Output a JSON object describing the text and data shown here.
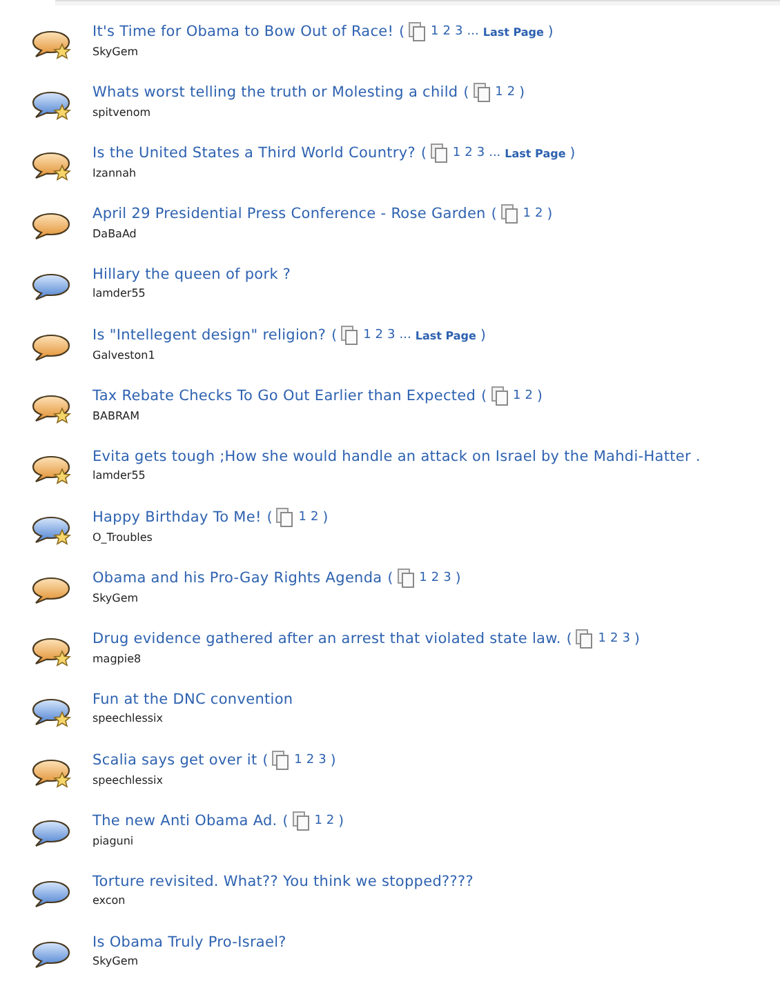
{
  "topics": [
    {
      "title": "It's Time for Obama to Bow Out of Race!",
      "author": "SkyGem",
      "hot": true,
      "starred": true,
      "pager": {
        "open": "(",
        "links": [
          {
            "kind": "page",
            "text": "1"
          },
          {
            "kind": "page",
            "text": "2"
          },
          {
            "kind": "page",
            "text": "3"
          },
          {
            "kind": "gap",
            "text": "..."
          },
          {
            "kind": "last",
            "text": "Last Page"
          }
        ],
        "close": ")"
      }
    },
    {
      "title": "Whats worst telling the truth or Molesting a child",
      "author": "spitvenom",
      "hot": false,
      "starred": true,
      "pager": {
        "open": "(",
        "links": [
          {
            "kind": "page",
            "text": "1"
          },
          {
            "kind": "page",
            "text": "2"
          }
        ],
        "close": ")"
      }
    },
    {
      "title": "Is the United States a Third World Country?",
      "author": "Izannah",
      "hot": true,
      "starred": true,
      "pager": {
        "open": "(",
        "links": [
          {
            "kind": "page",
            "text": "1"
          },
          {
            "kind": "page",
            "text": "2"
          },
          {
            "kind": "page",
            "text": "3"
          },
          {
            "kind": "gap",
            "text": "..."
          },
          {
            "kind": "last",
            "text": "Last Page"
          }
        ],
        "close": ")"
      }
    },
    {
      "title": "April 29 Presidential Press Conference - Rose Garden",
      "author": "DaBaAd",
      "hot": true,
      "starred": false,
      "pager": {
        "open": "(",
        "links": [
          {
            "kind": "page",
            "text": "1"
          },
          {
            "kind": "page",
            "text": "2"
          }
        ],
        "close": ")"
      }
    },
    {
      "title": "Hillary the queen of pork ?",
      "author": "lamder55",
      "hot": false,
      "starred": false
    },
    {
      "title": "Is \"Intellegent design\" religion?",
      "author": "Galveston1",
      "hot": true,
      "starred": false,
      "pager": {
        "open": "(",
        "links": [
          {
            "kind": "page",
            "text": "1"
          },
          {
            "kind": "page",
            "text": "2"
          },
          {
            "kind": "page",
            "text": "3"
          },
          {
            "kind": "gap",
            "text": "..."
          },
          {
            "kind": "last",
            "text": "Last Page"
          }
        ],
        "close": ")"
      }
    },
    {
      "title": "Tax Rebate Checks To Go Out Earlier than Expected",
      "author": "BABRAM",
      "hot": true,
      "starred": true,
      "pager": {
        "open": "(",
        "links": [
          {
            "kind": "page",
            "text": "1"
          },
          {
            "kind": "page",
            "text": "2"
          }
        ],
        "close": ")"
      }
    },
    {
      "title": "Evita gets tough ;How she would handle an attack on Israel by the Mahdi-Hatter .",
      "author": "lamder55",
      "hot": true,
      "starred": true
    },
    {
      "title": "Happy Birthday To Me!",
      "author": "O_Troubles",
      "hot": false,
      "starred": true,
      "pager": {
        "open": "(",
        "links": [
          {
            "kind": "page",
            "text": "1"
          },
          {
            "kind": "page",
            "text": "2"
          }
        ],
        "close": ")"
      }
    },
    {
      "title": "Obama and his Pro-Gay Rights Agenda",
      "author": "SkyGem",
      "hot": true,
      "starred": false,
      "pager": {
        "open": "(",
        "links": [
          {
            "kind": "page",
            "text": "1"
          },
          {
            "kind": "page",
            "text": "2"
          },
          {
            "kind": "page",
            "text": "3"
          }
        ],
        "close": ")"
      }
    },
    {
      "title": "Drug evidence gathered after an arrest that violated state law.",
      "author": "magpie8",
      "hot": true,
      "starred": true,
      "pager": {
        "open": "(",
        "links": [
          {
            "kind": "page",
            "text": "1"
          },
          {
            "kind": "page",
            "text": "2"
          },
          {
            "kind": "page",
            "text": "3"
          }
        ],
        "close": ")"
      }
    },
    {
      "title": "Fun at the DNC convention",
      "author": "speechlessix",
      "hot": false,
      "starred": true
    },
    {
      "title": "Scalia says get over it",
      "author": "speechlessix",
      "hot": true,
      "starred": true,
      "pager": {
        "open": "(",
        "links": [
          {
            "kind": "page",
            "text": "1"
          },
          {
            "kind": "page",
            "text": "2"
          },
          {
            "kind": "page",
            "text": "3"
          }
        ],
        "close": ")"
      }
    },
    {
      "title": "The new Anti Obama Ad.",
      "author": "piaguni",
      "hot": false,
      "starred": false,
      "pager": {
        "open": "(",
        "links": [
          {
            "kind": "page",
            "text": "1"
          },
          {
            "kind": "page",
            "text": "2"
          }
        ],
        "close": ")"
      }
    },
    {
      "title": "Torture revisited. What?? You think we stopped????",
      "author": "excon",
      "hot": false,
      "starred": false
    },
    {
      "title": "Is Obama Truly Pro-Israel?",
      "author": "SkyGem",
      "hot": false,
      "starred": false
    }
  ]
}
